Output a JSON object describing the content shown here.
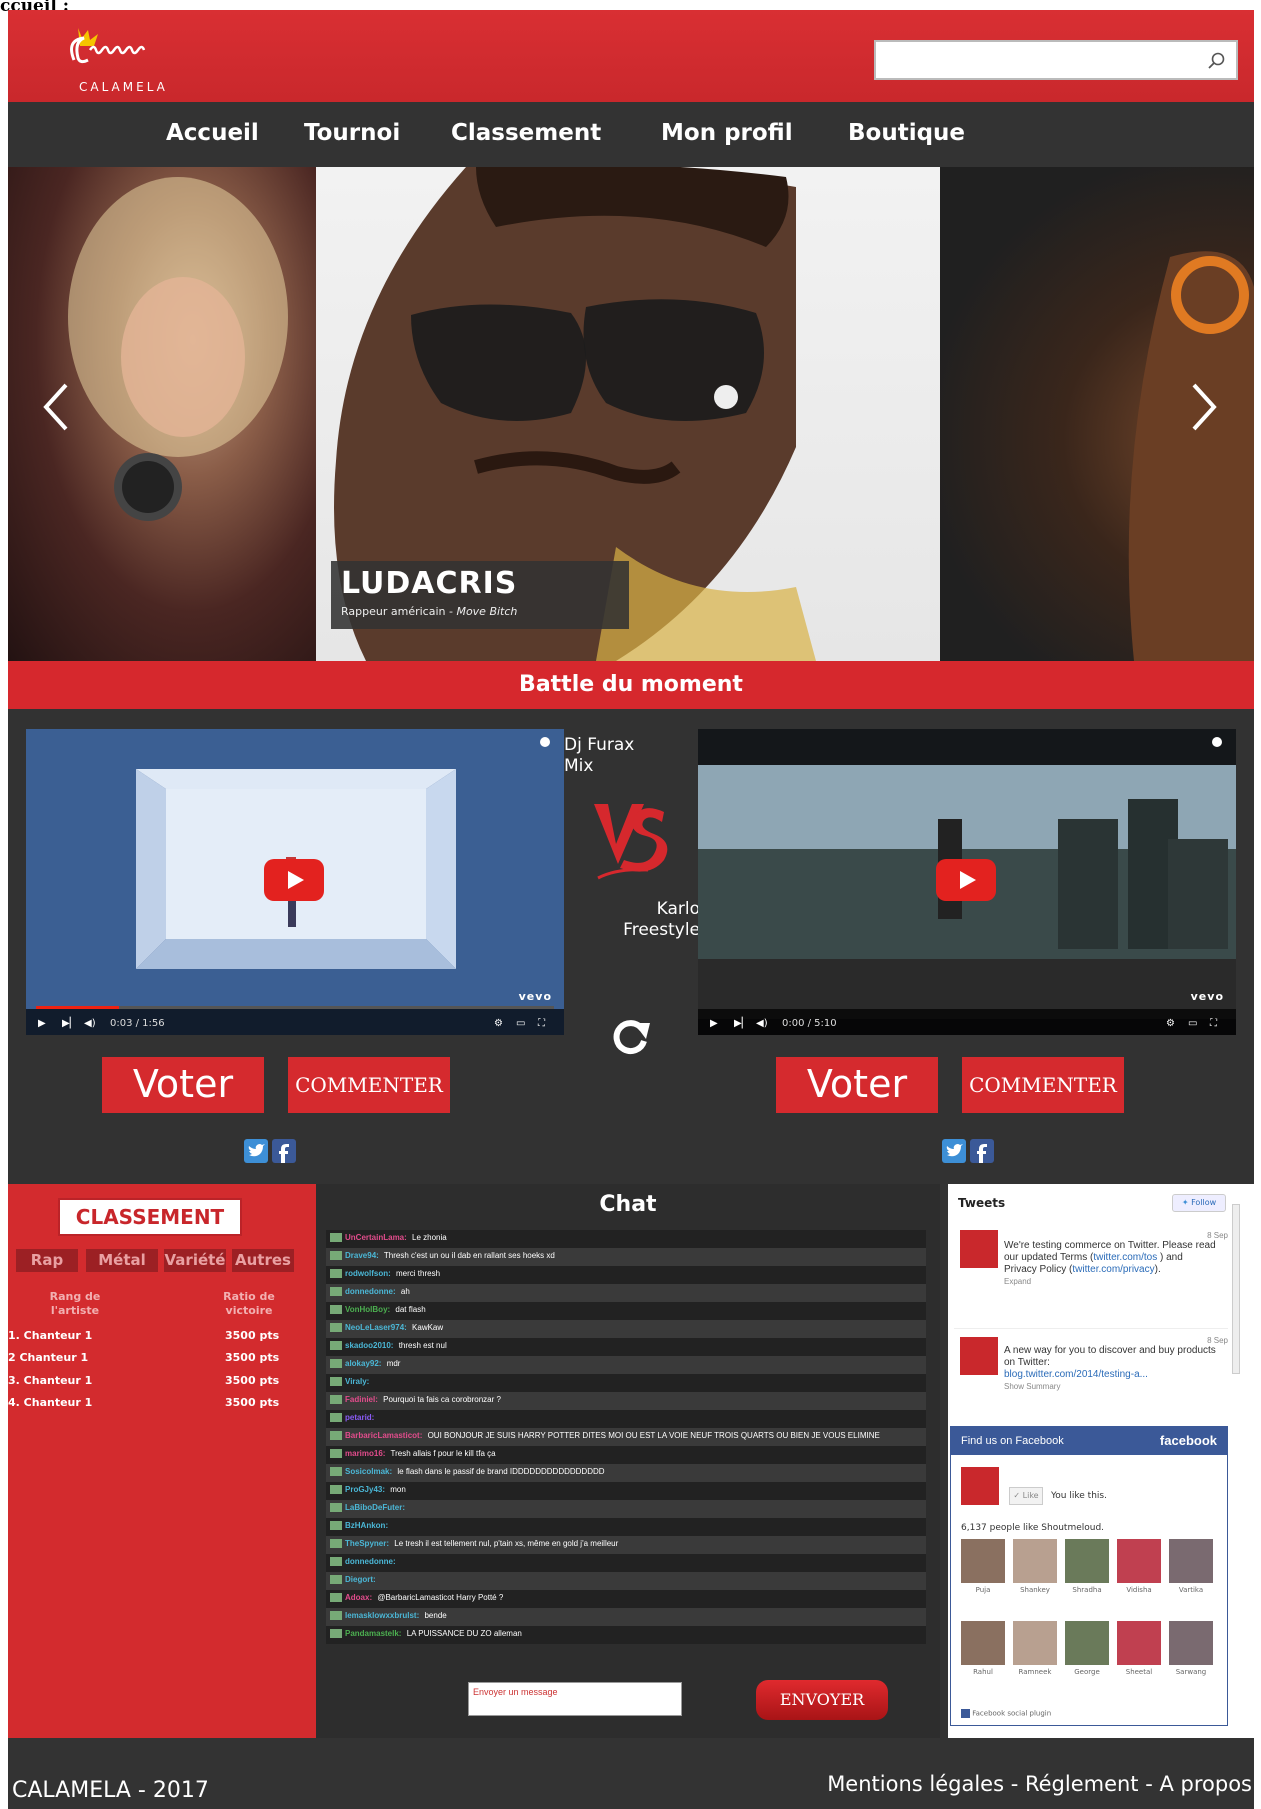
{
  "page_label": "ccueil :",
  "header": {
    "logo_text": "CALAMELA",
    "search_placeholder": ""
  },
  "nav": [
    "Accueil",
    "Tournoi",
    "Classement",
    "Mon profil",
    "Boutique"
  ],
  "carousel": {
    "name": "LUDACRIS",
    "subtitle_prefix": "Rappeur américain - ",
    "subtitle_song": "Move Bitch"
  },
  "battle": {
    "title": "Battle du moment",
    "left_artist_line1": "Dj Furax",
    "left_artist_line2": "Mix",
    "right_artist_line1": "Karlo",
    "right_artist_line2": "Freestyle",
    "left_video_time": "0:03 / 1:56",
    "right_video_time": "0:00 / 5:10",
    "vevo": "vevo",
    "vote_label": "Voter",
    "comment_label": "COMMENTER"
  },
  "ranking": {
    "title": "CLASSEMENT",
    "tabs": [
      "Rap",
      "Métal",
      "Variété",
      "Autres"
    ],
    "col1_header": "Rang de l'artiste",
    "col2_header": "Ratio de victoire",
    "rows": [
      {
        "name": "1. Chanteur 1",
        "points": "3500 pts"
      },
      {
        "name": "2 Chanteur 1",
        "points": "3500 pts"
      },
      {
        "name": "3. Chanteur 1",
        "points": "3500 pts"
      },
      {
        "name": "4. Chanteur 1",
        "points": "3500 pts"
      }
    ]
  },
  "chat": {
    "title": "Chat",
    "messages": [
      {
        "user": "UnCertainLama:",
        "text": "Le zhonia",
        "color": "#e24c8c"
      },
      {
        "user": "Drave94:",
        "text": "Thresh c'est un ou il dab en rallant ses hoeks xd",
        "color": "#4bb7d6"
      },
      {
        "user": "rodwolfson:",
        "text": "merci thresh",
        "color": "#4bb7d6"
      },
      {
        "user": "donnedonne:",
        "text": "ah",
        "color": "#4bb7d6"
      },
      {
        "user": "VonHolBoy:",
        "text": "dat flash",
        "color": "#4caf50"
      },
      {
        "user": "NeoLeLaser974:",
        "text": "KawKaw",
        "color": "#4bb7d6"
      },
      {
        "user": "skadoo2010:",
        "text": "thresh est nul",
        "color": "#4bb7d6"
      },
      {
        "user": "alokay92:",
        "text": "mdr",
        "color": "#4bb7d6"
      },
      {
        "user": "Viraly:",
        "text": "",
        "color": "#4bb7d6"
      },
      {
        "user": "Fadiniel:",
        "text": "Pourquoi ta fais ca corobronzar ?",
        "color": "#e24c8c"
      },
      {
        "user": "petarid:",
        "text": "",
        "color": "#8b5cf6"
      },
      {
        "user": "BarbaricLamasticot:",
        "text": "OUI BONJOUR JE SUIS HARRY POTTER DITES MOI OU EST LA VOIE NEUF TROIS QUARTS OU BIEN JE VOUS ELIMINE",
        "color": "#e24c8c"
      },
      {
        "user": "marimo16:",
        "text": "Tresh allais f pour le kill tfa ça",
        "color": "#e24c8c"
      },
      {
        "user": "Sosicolmak:",
        "text": "le flash dans le passif de brand IDDDDDDDDDDDDDDDD",
        "color": "#4bb7d6"
      },
      {
        "user": "ProGJy43:",
        "text": "mon",
        "color": "#4bb7d6"
      },
      {
        "user": "LaBiboDeFuter:",
        "text": "",
        "color": "#4bb7d6"
      },
      {
        "user": "BzHAnkon:",
        "text": "",
        "color": "#4bb7d6"
      },
      {
        "user": "TheSpyner:",
        "text": "Le tresh il est tellement nul, p'tain xs, même en gold j'a meilleur",
        "color": "#4bb7d6"
      },
      {
        "user": "donnedonne:",
        "text": "",
        "color": "#4bb7d6"
      },
      {
        "user": "Diegort:",
        "text": "",
        "color": "#4bb7d6"
      },
      {
        "user": "Adoax:",
        "text": "@BarbaricLamasticot Harry Potté ?",
        "color": "#e24c8c"
      },
      {
        "user": "lemasklowxxbrulst:",
        "text": "bende",
        "color": "#4bb7d6"
      },
      {
        "user": "Pandamastelk:",
        "text": "LA PUISSANCE DU ZO alleman",
        "color": "#4caf50"
      }
    ],
    "input_placeholder": "Envoyer un message",
    "send_label": "ENVOYER"
  },
  "tweets": {
    "header": "Tweets",
    "follow_label": "Follow",
    "items": [
      {
        "date": "8 Sep",
        "text": "We're testing commerce on Twitter. Please read our updated Terms (",
        "link1": "twitter.com/tos",
        "mid": " ) and Privacy Policy (",
        "link2": "twitter.com/privacy",
        "end": ").",
        "meta": "Expand"
      },
      {
        "date": "8 Sep",
        "text": "A new way for you to discover and buy products on Twitter:",
        "link1": "blog.twitter.com/2014/testing-a...",
        "meta": "Show Summary"
      }
    ]
  },
  "facebook": {
    "find_label": "Find us on Facebook",
    "brand": "facebook",
    "like_label": "Like",
    "liked_text": "You like this.",
    "count_text": "6,137 people like Shoutmeloud.",
    "faces_row1": [
      "Puja",
      "Shankey",
      "Shradha",
      "Vidisha",
      "Vartika"
    ],
    "faces_row2": [
      "Rahul",
      "Ramneek",
      "George",
      "Sheetal",
      "Sarwang"
    ],
    "plugin_label": "Facebook social plugin"
  },
  "footer": {
    "left": "CALAMELA - 2017",
    "links": [
      "Mentions légales",
      "Réglement",
      "A propos"
    ],
    "separator": " - "
  },
  "colors": {
    "brand_red": "#d6282d",
    "dark_bg": "#333333"
  }
}
